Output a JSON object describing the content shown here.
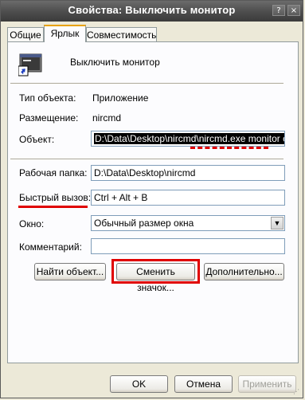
{
  "window": {
    "title": "Свойства: Выключить монитор",
    "help_btn": "?",
    "close_btn": "×"
  },
  "tabs": [
    {
      "label": "Общие",
      "active": false
    },
    {
      "label": "Ярлык",
      "active": true
    },
    {
      "label": "Совместимость",
      "active": false
    }
  ],
  "shortcut": {
    "name": "Выключить монитор",
    "icon": "application-shortcut-icon"
  },
  "info": {
    "type_label": "Тип объекта:",
    "type_value": "Приложение",
    "location_label": "Размещение:",
    "location_value": "nircmd"
  },
  "fields": {
    "target_label": "Объект:",
    "target_value": "D:\\Data\\Desktop\\nircmd\\nircmd.exe monitor off",
    "workdir_label": "Рабочая папка:",
    "workdir_value": "D:\\Data\\Desktop\\nircmd",
    "hotkey_label": "Быстрый вызов:",
    "hotkey_value": "Ctrl + Alt + B",
    "window_label": "Окно:",
    "window_value": "Обычный размер окна",
    "comment_label": "Комментарий:",
    "comment_value": ""
  },
  "buttons": {
    "find_target": "Найти объект...",
    "change_icon": "Сменить значок...",
    "advanced": "Дополнительно...",
    "ok": "OK",
    "cancel": "Отмена",
    "apply": "Применить"
  },
  "annotation_color": "#e00000"
}
